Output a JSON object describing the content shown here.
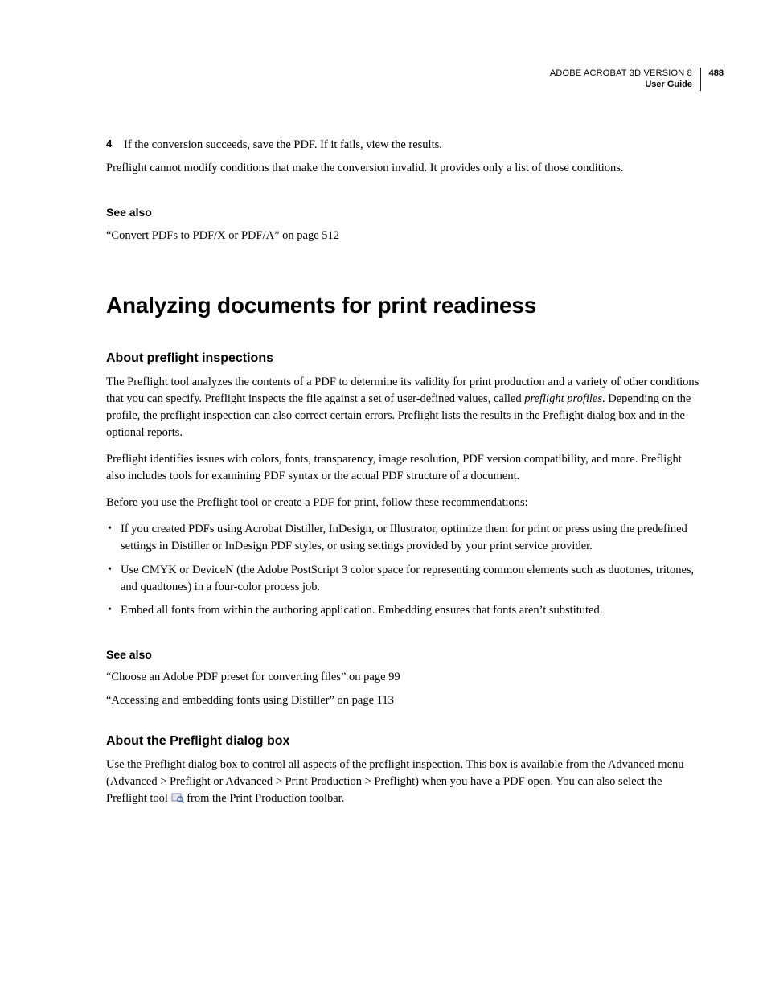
{
  "header": {
    "product": "ADOBE ACROBAT 3D VERSION 8",
    "subtitle": "User Guide",
    "page_number": "488"
  },
  "step4": {
    "num": "4",
    "text": "If the conversion succeeds, save the PDF. If it fails, view the results."
  },
  "note1": "Preflight cannot modify conditions that make the conversion invalid. It provides only a list of those conditions.",
  "see_also_1": {
    "heading": "See also",
    "link": "“Convert PDFs to PDF/X or PDF/A” on page 512"
  },
  "section_title": "Analyzing documents for print readiness",
  "about_inspections": {
    "heading": "About preflight inspections",
    "p1_a": "The Preflight tool analyzes the contents of a PDF to determine its validity for print production and a variety of other conditions that you can specify. Preflight inspects the file against a set of user-defined values, called ",
    "p1_em": "preflight profiles",
    "p1_b": ". Depending on the profile, the preflight inspection can also correct certain errors. Preflight lists the results in the Preflight dialog box and in the optional reports.",
    "p2": "Preflight identifies issues with colors, fonts, transparency, image resolution, PDF version compatibility, and more. Preflight also includes tools for examining PDF syntax or the actual PDF structure of a document.",
    "p3": "Before you use the Preflight tool or create a PDF for print, follow these recommendations:",
    "bullets": [
      "If you created PDFs using Acrobat Distiller, InDesign, or Illustrator, optimize them for print or press using the predefined settings in Distiller or InDesign PDF styles, or using settings provided by your print service provider.",
      "Use CMYK or DeviceN (the Adobe PostScript 3 color space for representing common elements such as duotones, tritones, and quadtones) in a four-color process job.",
      "Embed all fonts from within the authoring application. Embedding ensures that fonts aren’t substituted."
    ]
  },
  "see_also_2": {
    "heading": "See also",
    "links": [
      "“Choose an Adobe PDF preset for converting files” on page 99",
      "“Accessing and embedding fonts using Distiller” on page 113"
    ]
  },
  "about_dialog": {
    "heading": "About the Preflight dialog box",
    "p1_a": "Use the Preflight dialog box to control all aspects of the preflight inspection. This box is available from the Advanced menu (Advanced > Preflight or Advanced > Print Production > Preflight) when you have a PDF open. You can also select the Preflight tool ",
    "p1_b": " from the Print Production toolbar."
  }
}
